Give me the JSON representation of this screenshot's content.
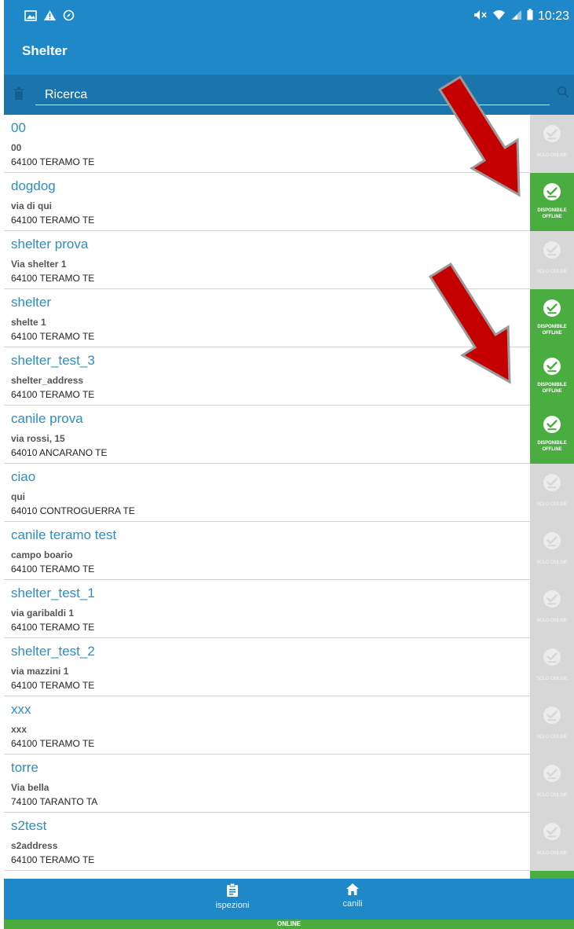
{
  "status_bar": {
    "time": "10:23"
  },
  "app_bar": {
    "title": "Shelter"
  },
  "search": {
    "placeholder": "Ricerca"
  },
  "shelters": [
    {
      "name": "00",
      "address": "00",
      "city": "64100 TERAMO  TE",
      "status": "online"
    },
    {
      "name": "dogdog",
      "address": "via di qui",
      "city": "64100 TERAMO  TE",
      "status": "offline"
    },
    {
      "name": "shelter prova",
      "address": "Via shelter 1",
      "city": "64100 TERAMO  TE",
      "status": "online"
    },
    {
      "name": "shelter",
      "address": "shelte 1",
      "city": "64100 TERAMO  TE",
      "status": "offline"
    },
    {
      "name": "shelter_test_3",
      "address": "shelter_address",
      "city": "64100 TERAMO  TE",
      "status": "offline"
    },
    {
      "name": "canile prova",
      "address": "via rossi, 15",
      "city": "64010 ANCARANO  TE",
      "status": "offline"
    },
    {
      "name": "ciao",
      "address": "qui",
      "city": "64010 CONTROGUERRA  TE",
      "status": "online"
    },
    {
      "name": "canile teramo test",
      "address": "campo boario",
      "city": "64100 TERAMO  TE",
      "status": "online"
    },
    {
      "name": "shelter_test_1",
      "address": "via garibaldi 1",
      "city": "64100 TERAMO  TE",
      "status": "online"
    },
    {
      "name": "shelter_test_2",
      "address": "via mazzini 1",
      "city": "64100 TERAMO  TE",
      "status": "online"
    },
    {
      "name": "xxx",
      "address": "xxx",
      "city": "64100 TERAMO  TE",
      "status": "online"
    },
    {
      "name": "torre",
      "address": "Via bella",
      "city": "74100 TARANTO  TA",
      "status": "online"
    },
    {
      "name": "s2test",
      "address": "s2address",
      "city": "64100 TERAMO  TE",
      "status": "online"
    },
    {
      "name": "",
      "address": "",
      "city": "",
      "status": "offline"
    }
  ],
  "badge_labels": {
    "offline_line1": "DISPONIBILE",
    "offline_line2": "OFFLINE",
    "online": "SOLO ONLINE"
  },
  "bottom_nav": {
    "inspections": "ispezioni",
    "kennels": "canili"
  },
  "connection_status": "ONLINE",
  "colors": {
    "primary": "#1e88c9",
    "primary_dark": "#1b75ad",
    "link": "#2a8fc4",
    "offline_green": "#4aad3f",
    "online_grey": "#d7d7d7",
    "arrow_red": "#c40000"
  }
}
